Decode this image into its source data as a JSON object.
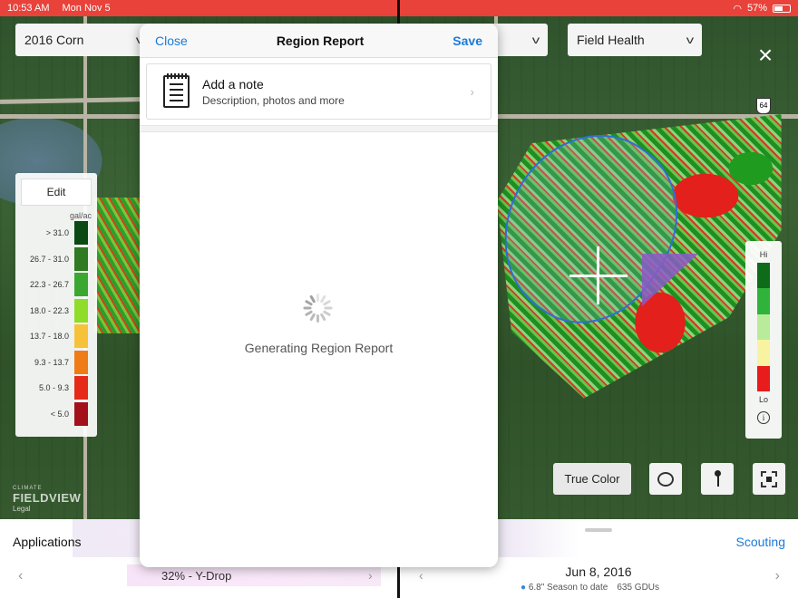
{
  "status_bar": {
    "time": "10:53 AM",
    "date": "Mon Nov 5",
    "battery": "57%"
  },
  "top_controls": {
    "left_dropdown": "2016 Corn",
    "right_dropdown": "Field Health",
    "road_sign": "64"
  },
  "modal": {
    "close_label": "Close",
    "title": "Region Report",
    "save_label": "Save",
    "note": {
      "title": "Add a note",
      "subtitle": "Description, photos and more"
    },
    "loading_text": "Generating Region Report"
  },
  "legend_left": {
    "edit_label": "Edit",
    "unit": "gal/ac",
    "rows": [
      {
        "label": "> 31.0",
        "color": "#0b4a12"
      },
      {
        "label": "26.7 - 31.0",
        "color": "#2f7a23"
      },
      {
        "label": "22.3 - 26.7",
        "color": "#3aa830"
      },
      {
        "label": "18.0 - 22.3",
        "color": "#8fdc2a"
      },
      {
        "label": "13.7 - 18.0",
        "color": "#f5c23a"
      },
      {
        "label": "9.3 - 13.7",
        "color": "#f07c16"
      },
      {
        "label": "5.0 - 9.3",
        "color": "#e62a1a"
      },
      {
        "label": "< 5.0",
        "color": "#a3101a"
      }
    ]
  },
  "legend_right": {
    "hi_label": "Hi",
    "lo_label": "Lo",
    "colors": [
      "#0d6b1a",
      "#2fb33a",
      "#b9ec9a",
      "#f8f3a0",
      "#e81c1c"
    ],
    "info_icon": "i"
  },
  "map_tools": {
    "true_color_label": "True Color"
  },
  "brand": {
    "small": "CLIMATE",
    "big": "FIELDVIEW",
    "legal": "Legal"
  },
  "bottom_bar": {
    "applications_label": "Applications",
    "scouting_label": "Scouting",
    "layer_label": "32% - Y-Drop",
    "date": "Jun 8, 2016",
    "season": "6.8\" Season to date",
    "gdus": "635 GDUs"
  }
}
